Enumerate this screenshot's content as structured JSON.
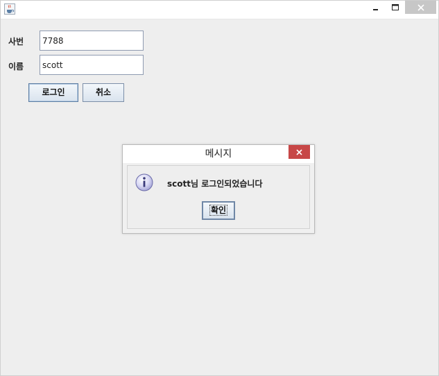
{
  "window": {
    "icon": "java-cup-icon",
    "controls": [
      "minimize-icon",
      "maximize-icon",
      "close-icon"
    ]
  },
  "form": {
    "emp_no_label": "사번",
    "emp_no_value": "7788",
    "name_label": "이름",
    "name_value": "scott",
    "login_button": "로그인",
    "cancel_button": "취소"
  },
  "dialog": {
    "title": "메시지",
    "icon": "info-icon",
    "message": "scott님 로그인되었습니다",
    "ok_button": "확인"
  },
  "colors": {
    "window_bg": "#eeeeee",
    "dialog_close_bg": "#c74747",
    "titlebar_close_bg": "#c7c7c7"
  }
}
